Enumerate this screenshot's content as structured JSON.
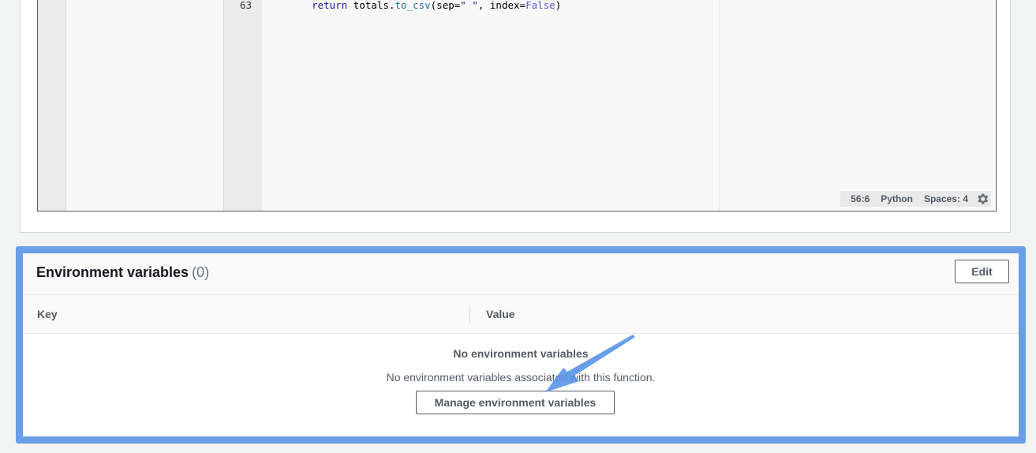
{
  "editor": {
    "line_number": "63",
    "code": {
      "indent": "    ",
      "keyword": "return",
      "object": " totals.",
      "method": "to_csv",
      "open": "(sep=",
      "string": "\" \"",
      "middle": ", index=",
      "constant": "False",
      "close": ")"
    },
    "status": {
      "cursor": "56:6",
      "language": "Python",
      "indent": "Spaces: 4"
    },
    "settings_icon": "gear-icon"
  },
  "env_vars": {
    "title": "Environment variables",
    "count": "(0)",
    "edit_label": "Edit",
    "columns": [
      "Key",
      "Value"
    ],
    "empty_title": "No environment variables",
    "empty_description": "No environment variables associated with this function.",
    "manage_label": "Manage environment variables"
  },
  "colors": {
    "highlight_frame": "#6a9ee6",
    "arrow": "#5b95e6"
  }
}
